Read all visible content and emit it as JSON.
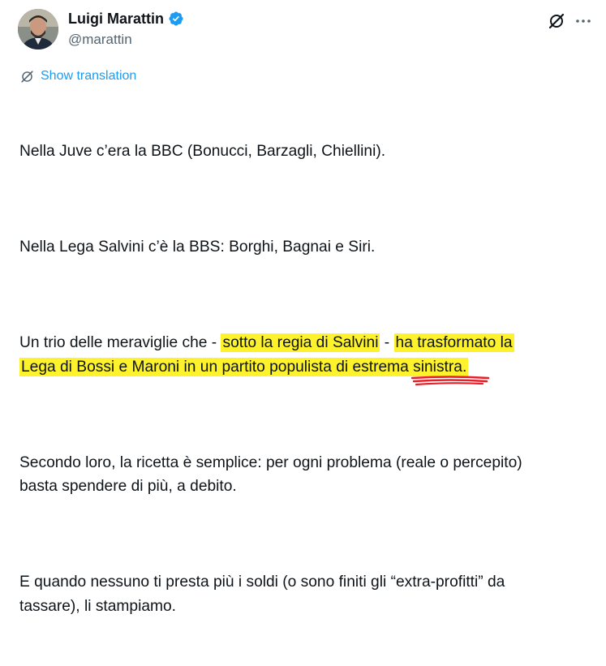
{
  "author": {
    "display_name": "Luigi Marattin",
    "handle": "@marattin",
    "avatar_icon": "profile-photo",
    "verified_icon": "verified-badge-icon",
    "verified_color": "#1d9bf0"
  },
  "actions": {
    "grok_icon": "grok-icon",
    "more_icon": "more-options-icon"
  },
  "translation": {
    "label": "Show translation",
    "icon": "translate-icon",
    "color": "#1d9bf0"
  },
  "tweet": {
    "p1": "Nella Juve c’era la BBC (Bonucci, Barzagli, Chiellini).",
    "p2": "Nella Lega Salvini c’è la BBS: Borghi, Bagnai e Siri.",
    "p3_a": "Un trio delle meraviglie che - ",
    "p3_hl1": "sotto la regia di Salvini",
    "p3_b": " - ",
    "p3_hl2a": "ha trasformato la",
    "p3_hl2b": "Lega di Bossi e Maroni in un partito populista di estrema ",
    "p3_hl2c": "sinistra",
    "p3_hl2d": ".",
    "p4": "Secondo loro, la ricetta è semplice: per ogni problema (reale o percepito)\nbasta spendere di più, a debito.",
    "p5": "E quando nessuno ti presta più i soldi (o sono finiti gli “extra-profitti” da\ntassare), li stampiamo."
  },
  "annotations": {
    "highlight_color": "#fdf22b",
    "underline_color": "#e8202a"
  }
}
